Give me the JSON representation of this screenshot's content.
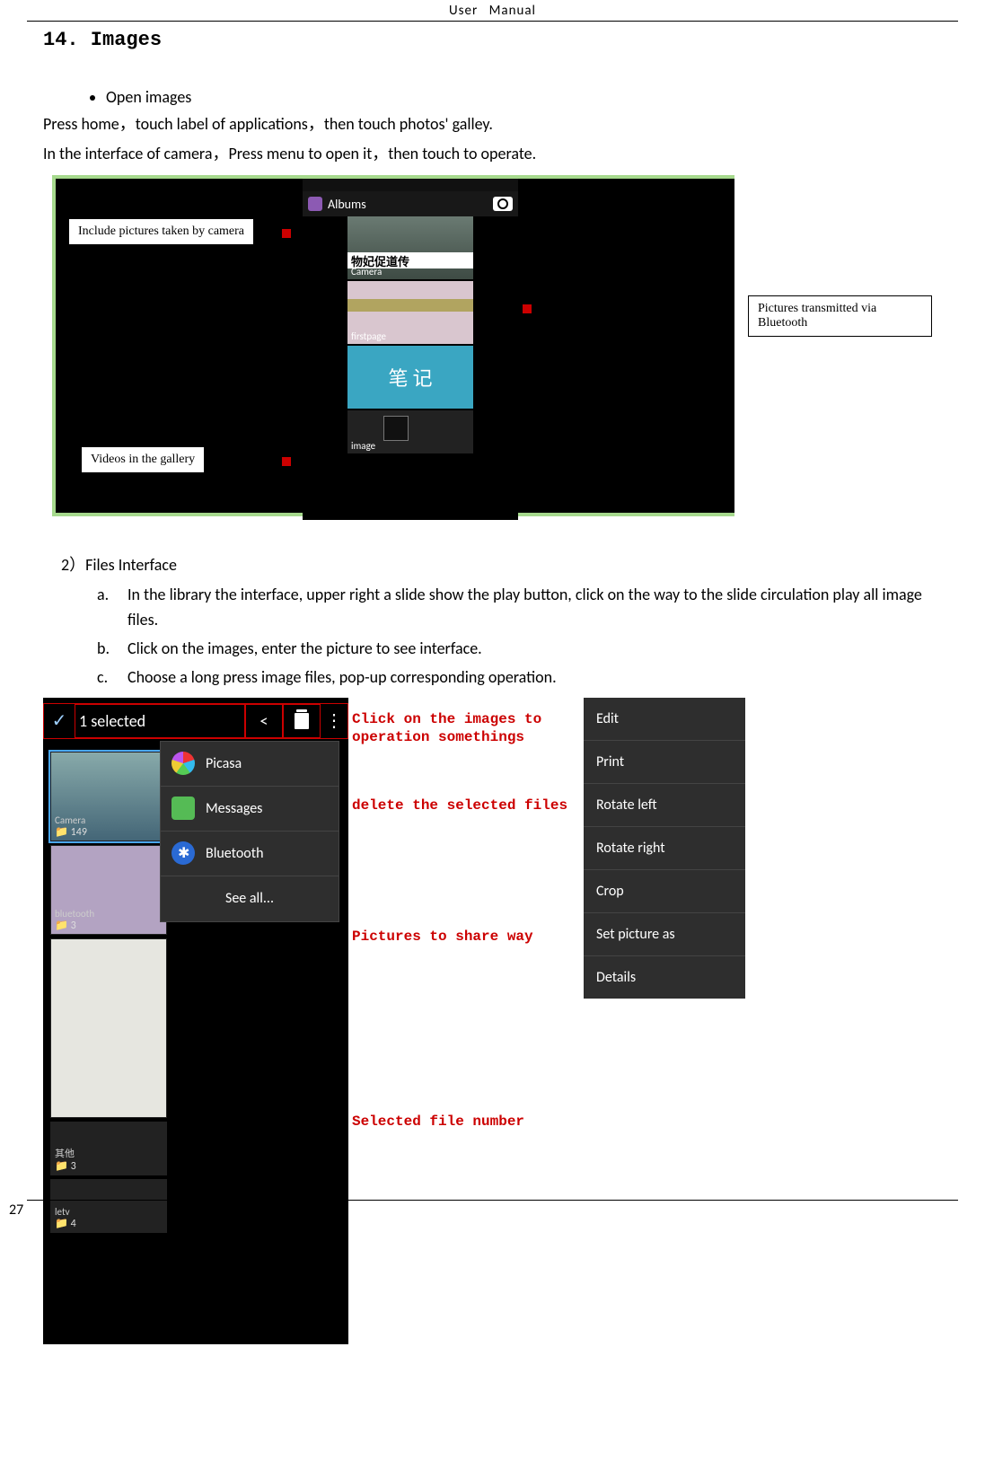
{
  "header": {
    "left": "User",
    "right": "Manual"
  },
  "section": {
    "title": "14. Images"
  },
  "intro": {
    "bullet": "Open images",
    "p1": "Press home，touch label of applications，then touch photos' galley.",
    "p2": "In the interface of camera，Press menu to open it，then touch to operate."
  },
  "fig1": {
    "albums_title": "Albums",
    "callout_camera": "Include pictures taken by camera",
    "callout_bluetooth": "Pictures transmitted via Bluetooth",
    "callout_videos": "Videos in the gallery",
    "tile_camera": "Camera",
    "tile_camera_stripe": "物妃促道传",
    "tile_firstpage": "firstpage",
    "tile_notes": "笔 记",
    "tile_image": "image"
  },
  "sec2": {
    "heading": "2）Files Interface",
    "a": "In the library the interface, upper right a slide show the play button, click on the way to the slide circulation play all image files.",
    "b": "Click on the images, enter the picture to see interface.",
    "c": "Choose a long press image files, pop-up corresponding operation."
  },
  "fig2": {
    "selected_text": "1 selected",
    "share_glyph": "<",
    "menu_glyph": "⋮",
    "dropdown": {
      "picasa": "Picasa",
      "messages": "Messages",
      "bluetooth": "Bluetooth",
      "see_all": "See all..."
    },
    "tiles": {
      "camera": "Camera",
      "camera_sub": "📁 149",
      "bluetooth": "bluetooth",
      "bluetooth_sub": "📁 3",
      "qita": "其他",
      "qita_sub": "📁 3",
      "letv": "letv",
      "letv_sub": "📁 4"
    },
    "annotations": {
      "a1": "Click on the images to operation somethings",
      "a2": "delete the selected files",
      "a3": "Pictures to share way",
      "a4": "Selected file number"
    },
    "context_menu": {
      "edit": "Edit",
      "print": "Print",
      "rotate_left": "Rotate left",
      "rotate_right": "Rotate right",
      "crop": "Crop",
      "set_as": "Set picture as",
      "details": "Details"
    }
  },
  "page_number": "27"
}
